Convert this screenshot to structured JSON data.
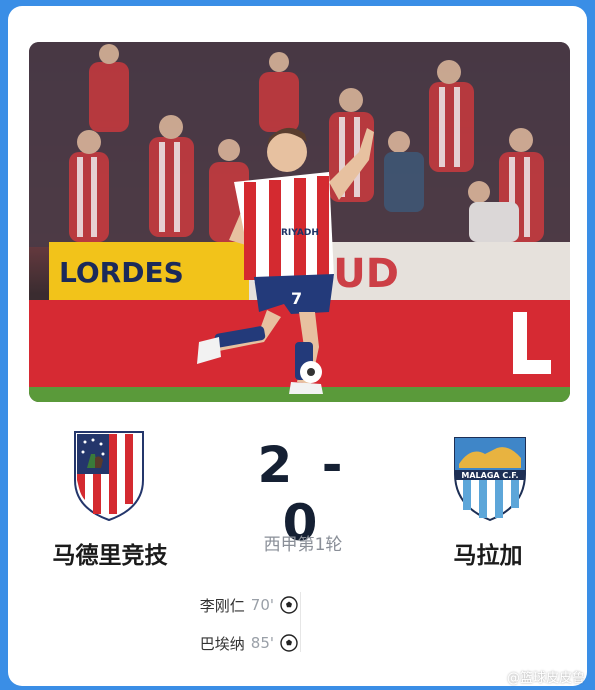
{
  "match": {
    "home_team": "马德里竞技",
    "away_team": "马拉加",
    "score": "2 - 0",
    "round": "西甲第1轮"
  },
  "scorers": [
    {
      "name": "李刚仁",
      "minute": "70'"
    },
    {
      "name": "巴埃纳",
      "minute": "85'"
    }
  ],
  "photo": {
    "banner_text": "LORDES",
    "jersey_sponsor": "RIYADH",
    "jersey_number": "7"
  },
  "watermark": "@篮球皮皮鲁",
  "colors": {
    "atletico_red": "#d42a30",
    "atletico_blue": "#24366b",
    "malaga_blue": "#5da6d9",
    "score_text": "#152033",
    "page_background": "#3a8ee6"
  }
}
